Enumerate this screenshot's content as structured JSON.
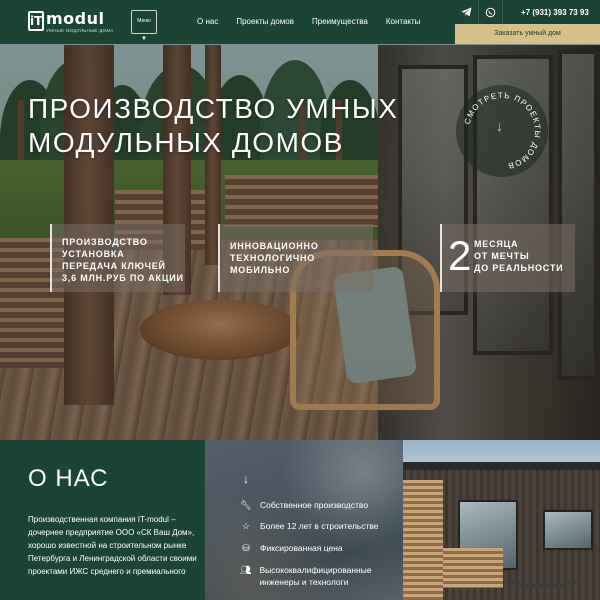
{
  "header": {
    "logo_mark": "iT",
    "logo_name": "modul",
    "logo_tagline": "умные модульные дома",
    "menu_label": "Меню",
    "nav": [
      "О нас",
      "Проекты домов",
      "Преимущества",
      "Контакты"
    ],
    "social_icons": [
      "telegram-icon",
      "whatsapp-icon"
    ],
    "phone": "+7 (931) 393 73 93",
    "order_button": "Заказать умный дом"
  },
  "hero": {
    "title_line1": "ПРОИЗВОДСТВО УМНЫХ",
    "title_line2": "МОДУЛЬНЫХ ДОМОВ",
    "round_button_text": "СМОТРЕТЬ ПРОЕКТЫ ДОМОВ",
    "cards": [
      {
        "lines": [
          "ПРОИЗВОДСТВО",
          "УСТАНОВКА",
          "ПЕРЕДАЧА КЛЮЧЕЙ",
          "3,6 МЛН.РУБ ПО АКЦИИ"
        ]
      },
      {
        "lines": [
          "ИННОВАЦИОННО",
          "ТЕХНОЛОГИЧНО",
          "МОБИЛЬНО"
        ]
      }
    ],
    "stat": {
      "number": "2",
      "lines": [
        "МЕСЯЦА",
        "ОТ МЕЧТЫ",
        "ДО РЕАЛЬНОСТИ"
      ]
    }
  },
  "about": {
    "title": "О НАС",
    "text": "Производственная компания IT-modul – дочернее предприятие ООО «СК Ваш Дом», хорошо известной на строительном рынке Петербурга и Ленинградской области своими проектами ИЖС среднего и премиального"
  },
  "features": [
    {
      "icon": "wrench-icon",
      "label": "Собственное производство"
    },
    {
      "icon": "star-icon",
      "label": "Более 12 лет в строительстве"
    },
    {
      "icon": "coins-icon",
      "label": "Фиксированная цена"
    },
    {
      "icon": "people-icon",
      "label": "Высококвалифицированные инженеры и технологи"
    }
  ],
  "colors": {
    "brand_green": "#1c4434",
    "accent_gold": "#d7c089"
  }
}
